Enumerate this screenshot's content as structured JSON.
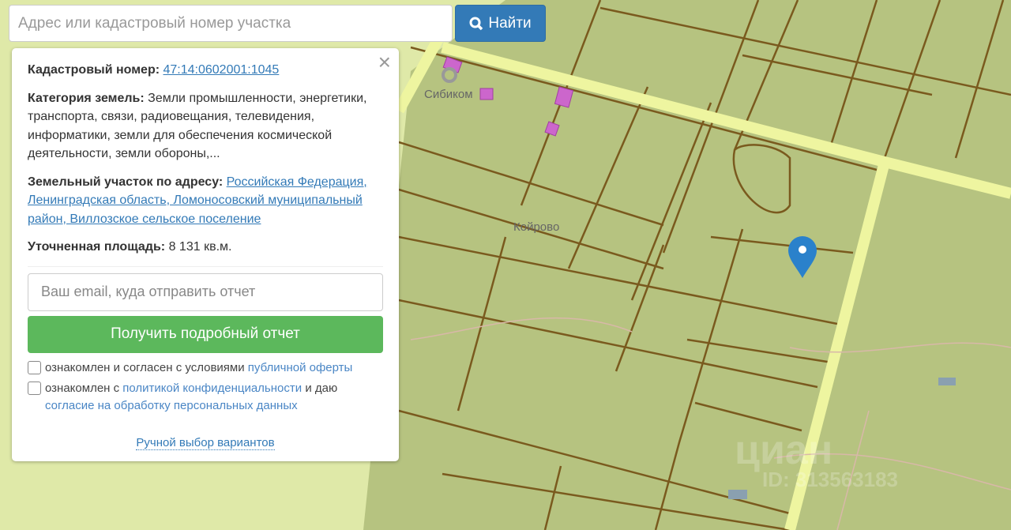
{
  "search": {
    "placeholder": "Адрес или кадастровый номер участка",
    "button": "Найти",
    "icon": "search-icon"
  },
  "panel": {
    "cadastral_label": "Кадастровый номер:",
    "cadastral_value": "47:14:0602001:1045",
    "category_label": "Категория земель:",
    "category_value": "Земли промышленности, энергетики, транспорта, связи, радиовещания, телевидения, информатики, земли для обеспечения космической деятельности, земли обороны,...",
    "address_label": "Земельный участок по адресу:",
    "address_value": "Российская Федерация, Ленинградская область, Ломоносовский муниципальный район, Виллозское сельское поселение",
    "area_label": "Уточненная площадь:",
    "area_value": "8 131 кв.м.",
    "email_placeholder": "Ваш email, куда отправить отчет",
    "get_report": "Получить подробный отчет",
    "consent1_text": "ознакомлен и согласен с условиями",
    "consent1_link": "публичной оферты",
    "consent2_text": "ознакомлен с",
    "consent2_link": "политикой конфиденциальности",
    "consent2_mid": "и даю",
    "consent2_link2": "согласие на обработку персональных данных",
    "manual": "Ручной выбор вариантов",
    "close": "×"
  },
  "map": {
    "labels": {
      "sibikom": "Сибиком",
      "koyrovo": "Койрово"
    },
    "watermark": "циан",
    "watermark_id": "ID: 313563183",
    "colors": {
      "land": "#b6c380",
      "road": "#eef5a0",
      "parcel": "#7a5a1e",
      "marker": "#2a81cb"
    }
  }
}
